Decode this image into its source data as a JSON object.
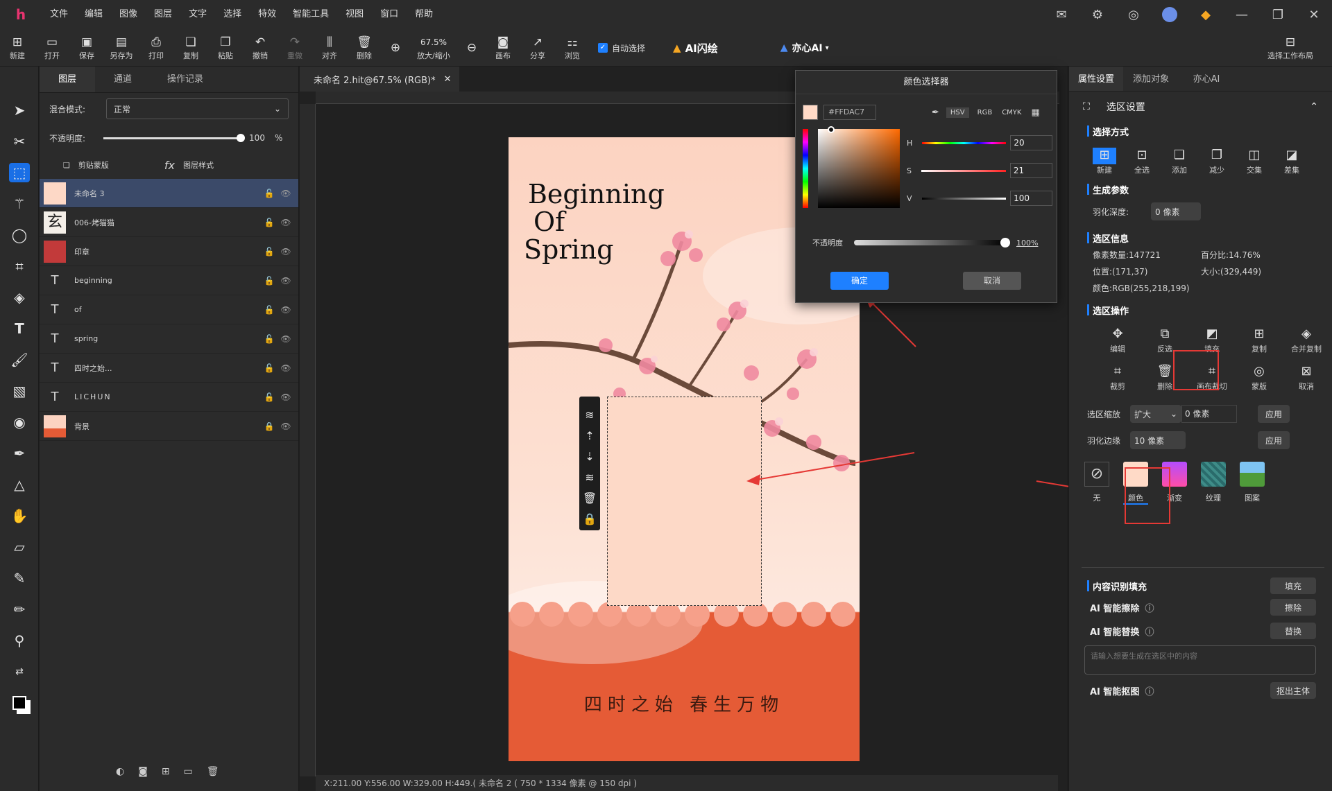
{
  "app": {
    "logo": "h"
  },
  "menu": [
    "文件",
    "编辑",
    "图像",
    "图层",
    "文字",
    "选择",
    "特效",
    "智能工具",
    "视图",
    "窗口",
    "帮助"
  ],
  "window_icons": [
    "mail-icon",
    "settings-icon",
    "compass-icon",
    "avatar",
    "vip-icon",
    "minimize-icon",
    "restore-icon",
    "close-icon"
  ],
  "toolbar": {
    "buttons": [
      "新建",
      "打开",
      "保存",
      "另存为",
      "打印",
      "复制",
      "粘贴",
      "撤销",
      "重做",
      "对齐",
      "删除"
    ],
    "zoom_value": "67.5%",
    "zoom_label": "放大/缩小",
    "buttons2": [
      "画布",
      "分享",
      "浏览"
    ],
    "auto_select": "自动选择",
    "ai_flash": "AI闪绘",
    "yixin_ai": "亦心AI",
    "workspace": "选择工作布局"
  },
  "layers_panel": {
    "tabs": [
      "图层",
      "通道",
      "操作记录"
    ],
    "blend_label": "混合模式:",
    "blend_value": "正常",
    "opacity_label": "不透明度:",
    "opacity_value": "100",
    "opacity_unit": "%",
    "clip_mask": "剪贴蒙版",
    "layer_style": "图层样式",
    "layers": [
      {
        "name": "未命名 3",
        "type": "color"
      },
      {
        "name": "006-烤猫猫",
        "type": "image"
      },
      {
        "name": "印章",
        "type": "image"
      },
      {
        "name": "beginning",
        "type": "text"
      },
      {
        "name": "of",
        "type": "text"
      },
      {
        "name": "spring",
        "type": "text"
      },
      {
        "name": "四时之始...",
        "type": "text"
      },
      {
        "name": "LICHUN",
        "type": "text"
      },
      {
        "name": "背景",
        "type": "image"
      }
    ]
  },
  "document": {
    "tab_title": "未命名 2.hit@67.5% (RGB)*",
    "poster_title": [
      "Beginning",
      "Of",
      "Spring"
    ],
    "poster_subtitle": "四时之始  春生万物",
    "status": "X:211.00 Y:556.00 W:329.00 H:449.(    未命名 2 ( 750 * 1334 像素 @ 150 dpi )"
  },
  "color_picker": {
    "title": "颜色选择器",
    "hex": "#FFDAC7",
    "modes": [
      "HSV",
      "RGB",
      "CMYK"
    ],
    "h_label": "H",
    "h_value": "20",
    "s_label": "S",
    "s_value": "21",
    "v_label": "V",
    "v_value": "100",
    "opacity_label": "不透明度",
    "opacity_value": "100%",
    "ok": "确定",
    "cancel": "取消",
    "swatch": "#FFDAC7"
  },
  "right_panel": {
    "tabs": [
      "属性设置",
      "添加对象",
      "亦心AI"
    ],
    "header": "选区设置",
    "select_mode_title": "选择方式",
    "select_modes": [
      "新建",
      "全选",
      "添加",
      "减少",
      "交集",
      "差集"
    ],
    "gen_params_title": "生成参数",
    "feather_label": "羽化深度:",
    "feather_value": "0 像素",
    "info_title": "选区信息",
    "info": {
      "pixels": "像素数量:147721",
      "percent": "百分比:14.76%",
      "position": "位置:(171,37)",
      "size": "大小:(329,449)",
      "color": "颜色:RGB(255,218,199)"
    },
    "ops_title": "选区操作",
    "ops_row1": [
      "编辑",
      "反选",
      "填充",
      "复制",
      "合并复制"
    ],
    "ops_row2": [
      "裁剪",
      "删除",
      "画布裁切",
      "蒙版",
      "取消"
    ],
    "scale_label": "选区缩放",
    "scale_mode": "扩大",
    "scale_value": "0 像素",
    "apply": "应用",
    "feather_edge_label": "羽化边缘",
    "feather_edge_value": "10 像素",
    "fills": [
      "无",
      "颜色",
      "渐变",
      "纹理",
      "图案"
    ],
    "cif_title": "内容识别填充",
    "cif_btn": "填充",
    "ai_erase": "AI 智能擦除",
    "ai_erase_btn": "擦除",
    "ai_replace": "AI 智能替换",
    "ai_replace_btn": "替换",
    "ai_placeholder": "请输入想要生成在选区中的内容",
    "ai_cutout": "AI 智能抠图",
    "ai_cutout_btn": "抠出主体"
  }
}
